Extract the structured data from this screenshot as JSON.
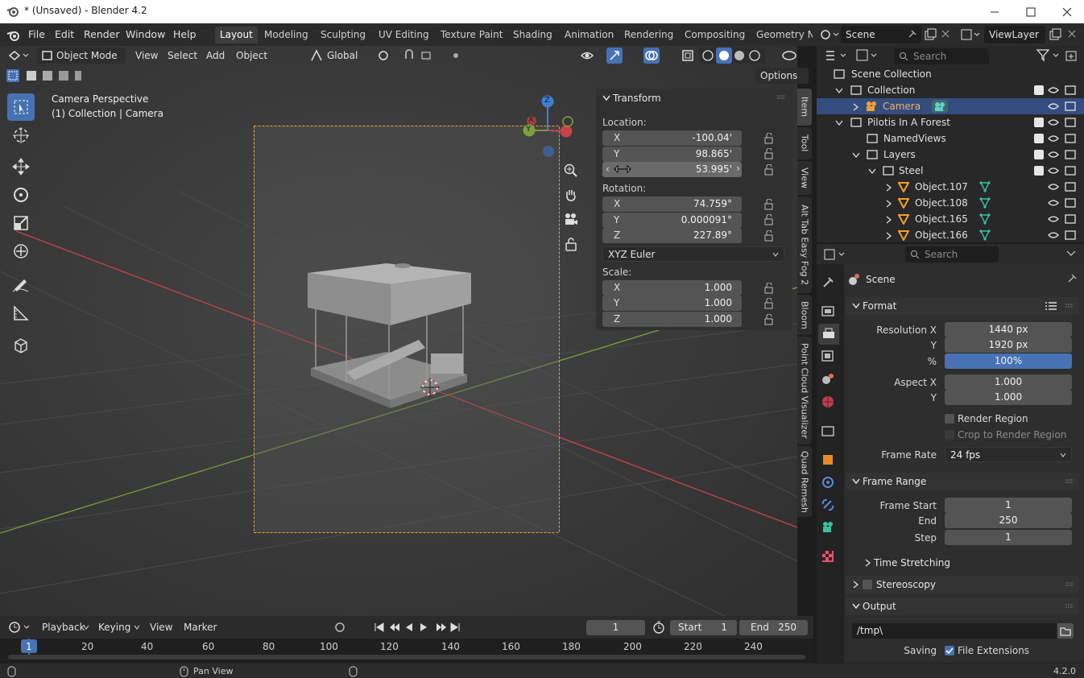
{
  "window": {
    "title": "* (Unsaved) - Blender 4.2"
  },
  "menu": [
    "File",
    "Edit",
    "Render",
    "Window",
    "Help"
  ],
  "workspaces": [
    "Layout",
    "Modeling",
    "Sculpting",
    "UV Editing",
    "Texture Paint",
    "Shading",
    "Animation",
    "Rendering",
    "Compositing",
    "Geometry No"
  ],
  "scene_name": "Scene",
  "view_layer": "ViewLayer",
  "viewport": {
    "mode": "Object Mode",
    "header_menus": [
      "View",
      "Select",
      "Add",
      "Object"
    ],
    "transform_orientation": "Global",
    "options_label": "Options",
    "overlay_title": "Camera Perspective",
    "overlay_subtitle": "(1) Collection | Camera"
  },
  "gizmo": {
    "z": "Z",
    "y": "Y",
    "x": "X"
  },
  "transform_panel": {
    "title": "Transform",
    "location_label": "Location:",
    "location": [
      {
        "axis": "X",
        "value": "-100.04'"
      },
      {
        "axis": "Y",
        "value": "98.865'"
      },
      {
        "axis": "Z",
        "value": "53.995'"
      }
    ],
    "rotation_label": "Rotation:",
    "rotation": [
      {
        "axis": "X",
        "value": "74.759°"
      },
      {
        "axis": "Y",
        "value": "0.000091°"
      },
      {
        "axis": "Z",
        "value": "227.89°"
      }
    ],
    "rotation_mode": "XYZ Euler",
    "scale_label": "Scale:",
    "scale": [
      {
        "axis": "X",
        "value": "1.000"
      },
      {
        "axis": "Y",
        "value": "1.000"
      },
      {
        "axis": "Z",
        "value": "1.000"
      }
    ]
  },
  "side_tabs": [
    "Item",
    "Tool",
    "View",
    "Alt Tab Easy Fog 2",
    "Bloom",
    "Point Cloud Visualizer",
    "Quad Remesh"
  ],
  "outliner": {
    "search_placeholder": "Search",
    "rows": [
      {
        "name": "Scene Collection"
      },
      {
        "name": "Collection"
      },
      {
        "name": "Camera"
      },
      {
        "name": "Pilotis In A Forest"
      },
      {
        "name": "NamedViews"
      },
      {
        "name": "Layers"
      },
      {
        "name": "Steel"
      },
      {
        "name": "Object.107"
      },
      {
        "name": "Object.108"
      },
      {
        "name": "Object.165"
      },
      {
        "name": "Object.166"
      }
    ]
  },
  "properties": {
    "search_placeholder": "Search",
    "context": "Scene",
    "format_header": "Format",
    "resolution_x_label": "Resolution X",
    "resolution_x": "1440 px",
    "resolution_y_label": "Y",
    "resolution_y": "1920 px",
    "percent_label": "%",
    "percent": "100%",
    "aspect_x_label": "Aspect X",
    "aspect_x": "1.000",
    "aspect_y_label": "Y",
    "aspect_y": "1.000",
    "render_region": "Render Region",
    "crop_region": "Crop to Render Region",
    "frame_rate_label": "Frame Rate",
    "frame_rate": "24 fps",
    "frame_range_header": "Frame Range",
    "frame_start_label": "Frame Start",
    "frame_start": "1",
    "end_label": "End",
    "end": "250",
    "step_label": "Step",
    "step": "1",
    "time_stretching": "Time Stretching",
    "stereoscopy": "Stereoscopy",
    "output_header": "Output",
    "output_path": "/tmp\\",
    "saving_label": "Saving",
    "file_extensions": "File Extensions"
  },
  "timeline": {
    "menus": [
      "Playback",
      "Keying",
      "View",
      "Marker"
    ],
    "current_frame": "1",
    "start_label": "Start",
    "start": "1",
    "end_label": "End",
    "end": "250",
    "ruler": [
      "1",
      "20",
      "40",
      "60",
      "80",
      "100",
      "120",
      "140",
      "160",
      "180",
      "200",
      "220",
      "240"
    ]
  },
  "statusbar": {
    "hint": "Pan View",
    "version": "4.2.0"
  },
  "colors": {
    "accent": "#4772b3",
    "selection": "#334d80",
    "camera_frame": "#f0a030",
    "x_axis": "#c8414b",
    "y_axis": "#7ea03c",
    "z_axis": "#3f7fd6"
  }
}
